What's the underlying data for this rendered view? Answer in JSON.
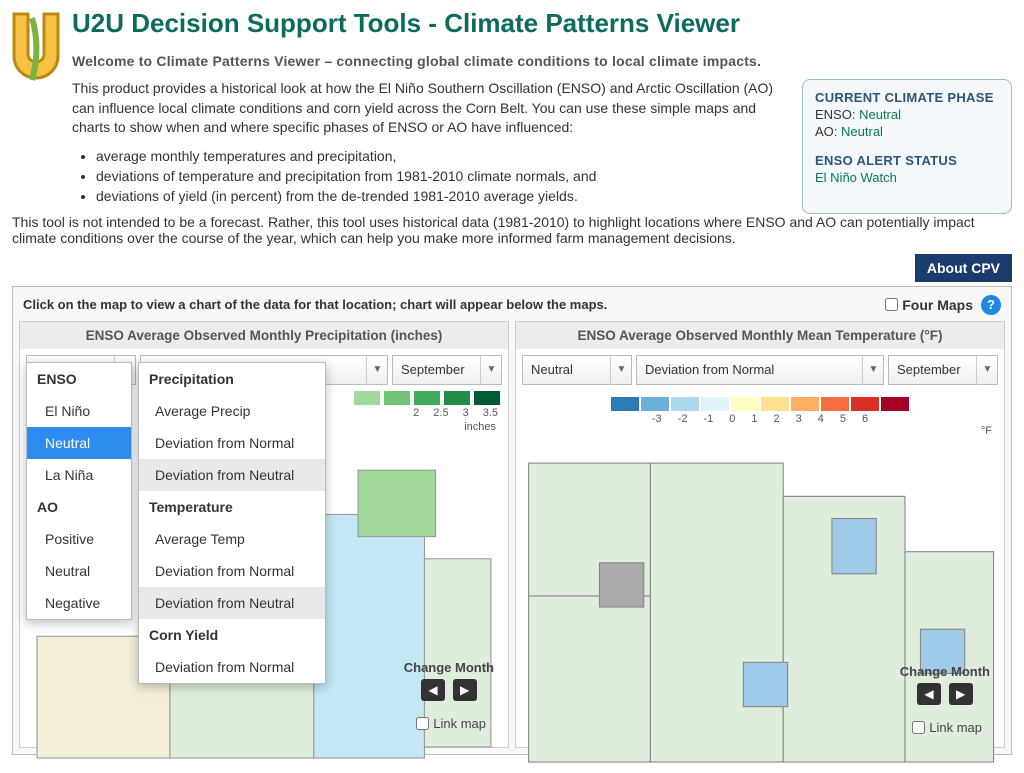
{
  "page_title": "U2U Decision Support Tools - Climate Patterns Viewer",
  "welcome": "Welcome to Climate Patterns Viewer – connecting global climate conditions to local climate impacts.",
  "intro_p1": "This product provides a historical look at how the El Niño Southern Oscillation (ENSO) and Arctic Oscillation (AO) can influence local climate conditions and corn yield across the Corn Belt. You can use these simple maps and charts to show when and where specific phases of ENSO or AO have influenced:",
  "intro_bullets": [
    "average monthly temperatures and precipitation,",
    "deviations of temperature and precipitation from 1981-2010 climate normals, and",
    "deviations of yield (in percent) from the de-trended 1981-2010 average yields."
  ],
  "intro_p2": "This tool is not intended to be a forecast. Rather, this tool uses historical data (1981-2010) to highlight locations where ENSO and AO can potentially impact climate conditions over the course of the year, which can help you make more informed farm management decisions.",
  "sidebox": {
    "phase_title": "CURRENT CLIMATE PHASE",
    "enso_label": "ENSO:",
    "enso_value": "Neutral",
    "ao_label": "AO:",
    "ao_value": "Neutral",
    "alert_title": "ENSO ALERT STATUS",
    "alert_value": "El Niño Watch"
  },
  "about_btn": "About CPV",
  "instr": "Click on the map to view a chart of the data for that location; chart will appear below the maps.",
  "four_maps": "Four Maps",
  "help_icon": "?",
  "panel_left": {
    "title": "ENSO Average Observed Monthly Precipitation (inches)",
    "sel_phase": "Neutral",
    "sel_var": "Deviation from Normal",
    "sel_month": "September",
    "legend_ticks": [
      "2",
      "2.5",
      "3",
      "3.5"
    ],
    "legend_unit": "inches",
    "change_month": "Change Month",
    "link_map": "Link map"
  },
  "panel_right": {
    "title": "ENSO Average Observed Monthly Mean Temperature (°F)",
    "sel_phase": "Neutral",
    "sel_var": "Deviation from Normal",
    "sel_month": "September",
    "legend_ticks": [
      "-3",
      "-2",
      "-1",
      "0",
      "1",
      "2",
      "3",
      "4",
      "5",
      "6"
    ],
    "legend_unit": "°F",
    "change_month": "Change Month",
    "link_map": "Link map"
  },
  "phase_dropdown": {
    "group1": "ENSO",
    "opts1": [
      "El Niño",
      "Neutral",
      "La Niña"
    ],
    "group2": "AO",
    "opts2": [
      "Positive",
      "Neutral",
      "Negative"
    ],
    "selected": "Neutral"
  },
  "var_dropdown": {
    "group1": "Precipitation",
    "opts1": [
      "Average Precip",
      "Deviation from Normal",
      "Deviation from Neutral"
    ],
    "group2": "Temperature",
    "opts2": [
      "Average Temp",
      "Deviation from Normal",
      "Deviation from Neutral"
    ],
    "group3": "Corn Yield",
    "opts3": [
      "Deviation from Normal"
    ]
  },
  "precip_colors": [
    "#c7e9c0",
    "#a1d99b",
    "#74c476",
    "#41ab5d",
    "#238b45",
    "#005a32"
  ],
  "temp_colors": [
    "#2c7bb6",
    "#6bb0d8",
    "#abd9e9",
    "#e0f3f8",
    "#ffffbf",
    "#fee090",
    "#fdae61",
    "#f46d43",
    "#d73027",
    "#a50026"
  ]
}
